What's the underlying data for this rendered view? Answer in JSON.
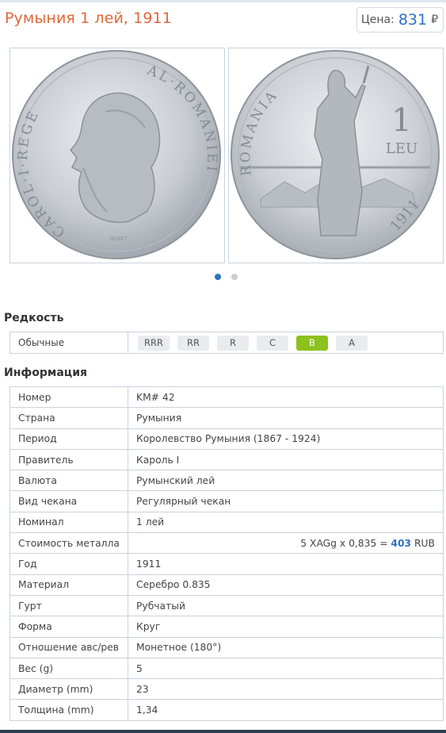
{
  "header": {
    "title": "Румыния 1 лей, 1911",
    "price_label": "Цена:",
    "price_value": "831",
    "price_currency": "₽"
  },
  "images": {
    "obverse": {
      "legend_left": "CAROL·I·REGE",
      "legend_right": "AL·ROMANIEI",
      "engraver": "TASSET"
    },
    "reverse": {
      "legend": "ROMANIA",
      "denomination": "1",
      "unit": "LEU",
      "year": "1911"
    },
    "carousel_pages": 2,
    "carousel_active": 1
  },
  "rarity": {
    "section_title": "Редкость",
    "label": "Обычные",
    "grades": [
      "RRR",
      "RR",
      "R",
      "C",
      "B",
      "A"
    ],
    "selected": "B",
    "accent_color": "#8cc11e"
  },
  "info": {
    "section_title": "Информация",
    "rows": [
      {
        "key": "Номер",
        "value": "KM# 42"
      },
      {
        "key": "Страна",
        "value": "Румыния"
      },
      {
        "key": "Период",
        "value": "Королевство Румыния (1867 - 1924)"
      },
      {
        "key": "Правитель",
        "value": "Кароль I"
      },
      {
        "key": "Валюта",
        "value": "Румынский лей"
      },
      {
        "key": "Вид чекана",
        "value": "Регулярный чекан"
      },
      {
        "key": "Номинал",
        "value": "1 лей"
      },
      {
        "key": "Стоимость металла",
        "value": ""
      },
      {
        "key": "Год",
        "value": "1911"
      },
      {
        "key": "Материал",
        "value": "Серебро 0.835"
      },
      {
        "key": "Гурт",
        "value": "Рубчатый"
      },
      {
        "key": "Форма",
        "value": "Круг"
      },
      {
        "key": "Отношение авс/рев",
        "value": "Монетное (180°)"
      },
      {
        "key": "Вес (g)",
        "value": "5"
      },
      {
        "key": "Диаметр (mm)",
        "value": "23"
      },
      {
        "key": "Толщина (mm)",
        "value": "1,34"
      }
    ],
    "metal_value": {
      "prefix": "5 XAGg x 0,835 =",
      "amount": "403",
      "currency": "RUB"
    }
  },
  "colors": {
    "title": "#e2663a",
    "accent_blue": "#2d72c6",
    "border": "#c9d3dd"
  }
}
